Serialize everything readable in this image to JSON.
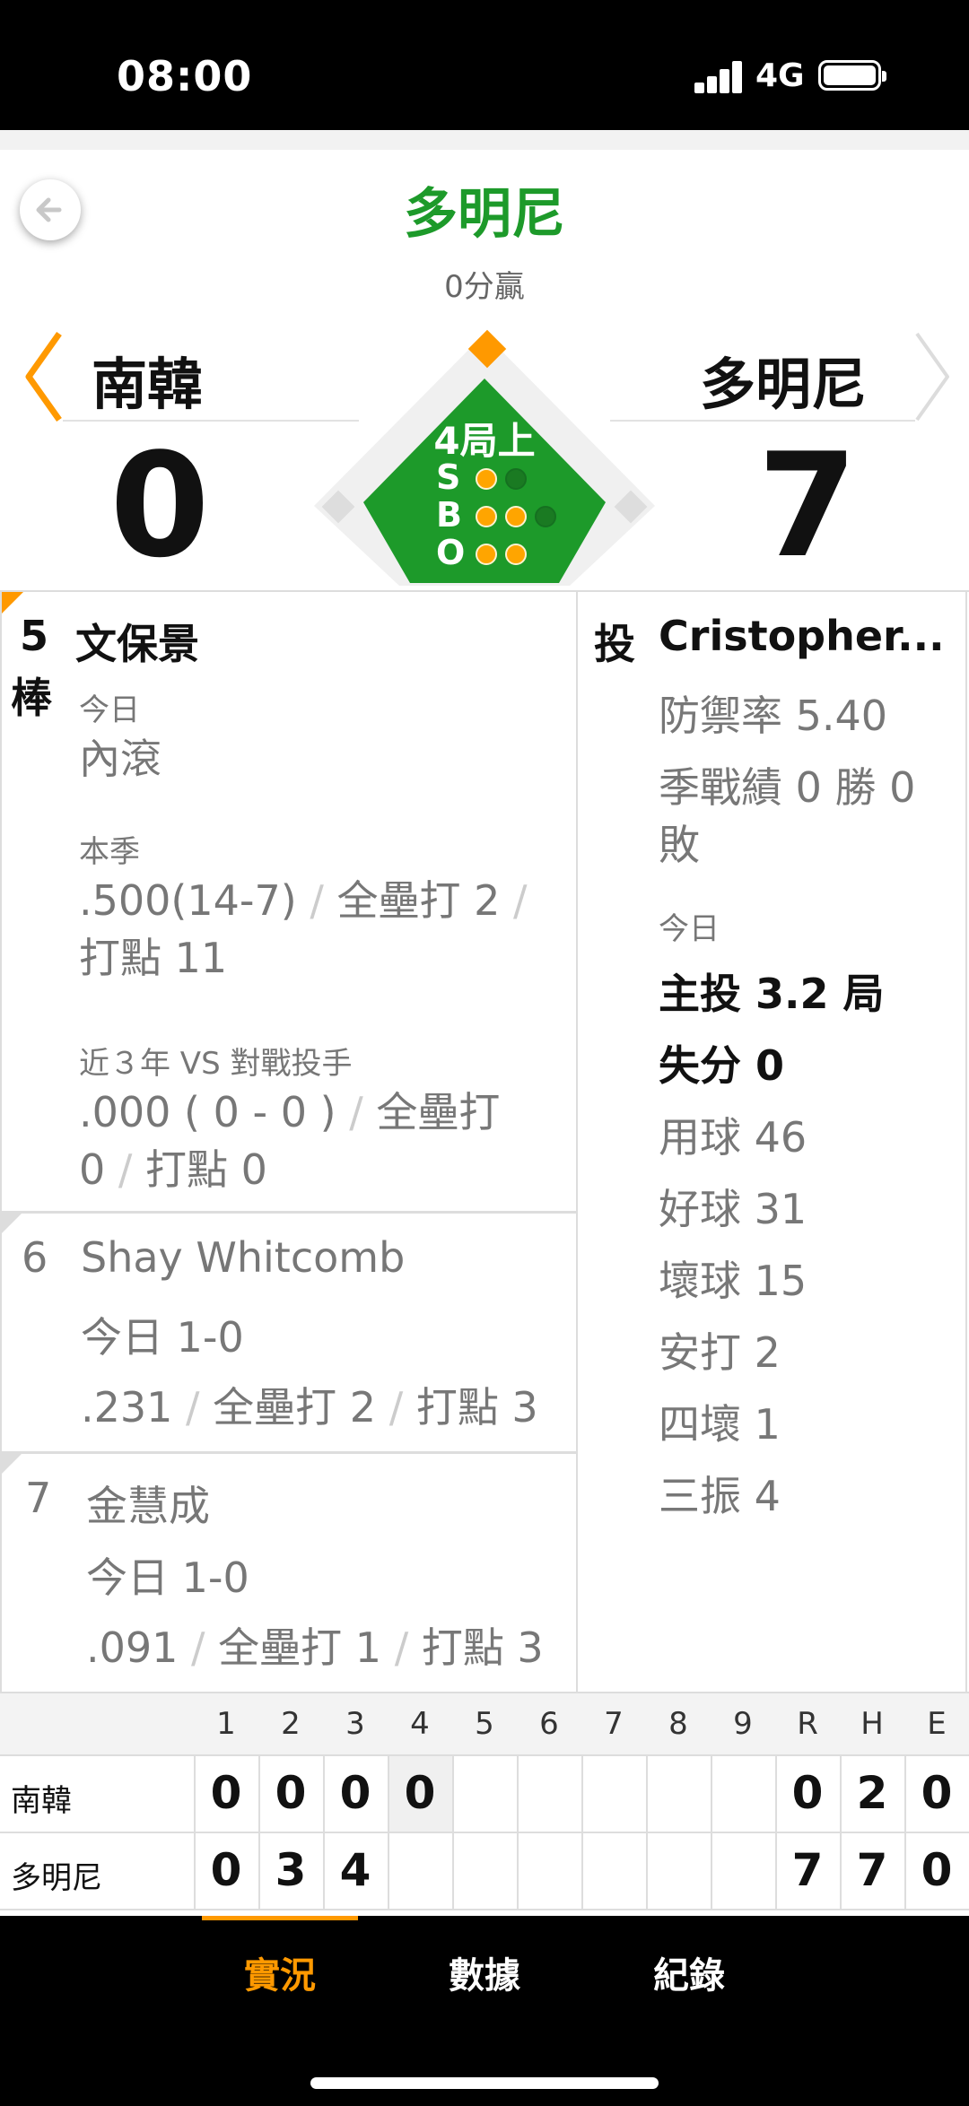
{
  "status_bar": {
    "time": "08:00",
    "network": "4G"
  },
  "header": {
    "title": "多明尼",
    "subtitle": "0分贏"
  },
  "game": {
    "away": {
      "name": "南韓",
      "score": "0"
    },
    "home": {
      "name": "多明尼",
      "score": "7"
    },
    "inning": "4局上",
    "count": {
      "s_label": "S",
      "b_label": "B",
      "o_label": "O",
      "strikes": 1,
      "balls": 2,
      "outs": 2
    }
  },
  "batters": [
    {
      "order": "5",
      "order_suffix": "棒",
      "name": "文保景",
      "today_label": "今日",
      "today": "內滾",
      "season_label": "本季",
      "season_avg": ".500(14-7)",
      "season_hr": "全壘打 2",
      "season_rbi": "打點 11",
      "vs_label": "近３年 VS 對戰投手",
      "vs_avg": ".000 ( 0 - 0 )",
      "vs_hr_a": "全壘打",
      "vs_hr_b": "0",
      "vs_rbi": "打點 0"
    },
    {
      "order": "6",
      "name": "Shay Whitcomb",
      "today": "今日 1-0",
      "avg": ".231",
      "hr": "全壘打 2",
      "rbi": "打點 3"
    },
    {
      "order": "7",
      "name": "金慧成",
      "today": "今日 1-0",
      "avg": ".091",
      "hr": "全壘打 1",
      "rbi": "打點 3"
    }
  ],
  "pitcher": {
    "role": "投",
    "name": "Cristopher...",
    "era": "防禦率 5.40",
    "record_a": "季戰績 0 勝 0",
    "record_b": "敗",
    "today_label": "今日",
    "innings": "主投 3.2 局",
    "runs": "失分 0",
    "pitches": "用球 46",
    "strikes": "好球 31",
    "balls": "壞球 15",
    "hits": "安打 2",
    "walks": "四壞 1",
    "strikeouts": "三振 4"
  },
  "scoreboard": {
    "headers": [
      "1",
      "2",
      "3",
      "4",
      "5",
      "6",
      "7",
      "8",
      "9",
      "R",
      "H",
      "E"
    ],
    "rows": [
      {
        "team": "南韓",
        "innings": [
          "0",
          "0",
          "0",
          "0",
          "",
          "",
          "",
          "",
          ""
        ],
        "r": "0",
        "h": "2",
        "e": "0"
      },
      {
        "team": "多明尼",
        "innings": [
          "0",
          "3",
          "4",
          "",
          "",
          "",
          "",
          "",
          ""
        ],
        "r": "7",
        "h": "7",
        "e": "0"
      }
    ]
  },
  "nav": {
    "items": [
      "實況",
      "數據",
      "紀錄"
    ],
    "active": 0
  },
  "colors": {
    "accent": "#ff9900",
    "field_green": "#1d9a2a",
    "title_green": "#1d9a2a"
  },
  "icons": {
    "back": "back-arrow-icon",
    "prev": "chevron-left-icon",
    "next": "chevron-right-icon"
  }
}
